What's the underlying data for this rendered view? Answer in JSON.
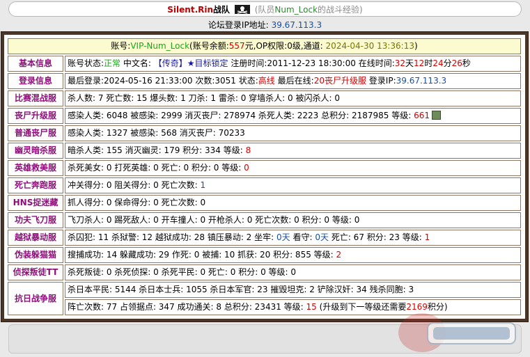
{
  "header": {
    "site": "Silent.Rin",
    "team_suffix": "战队",
    "member_prefix": "(队员",
    "member_name": "Num_Lock",
    "member_suffix": "的战斗经验)"
  },
  "ip_line": {
    "label": "论坛登录IP地址:",
    "value": "39.67.113.3"
  },
  "account": {
    "label": "账号:",
    "name": "VIP-Num_Lock",
    "balance_label": "(账号余额:",
    "balance": "557",
    "balance_unit": "元,OP权限:",
    "op_level": "0级,通道:",
    "datetime": "2024-04-30 13:36:13",
    "end": ")"
  },
  "rows": {
    "basic": {
      "label": "基本信息",
      "status_label": "账号状态:",
      "status": "正常",
      "cn_label": "中文名:",
      "cn_name": "【传奇】★目标锁定",
      "reg_label": "注册时间:",
      "reg_time": "2011-12-23 18:30:00",
      "online_label": "在线时间:",
      "days": "32",
      "d_unit": "天",
      "hours": "12",
      "h_unit": "时",
      "mins": "24",
      "m_unit": "分",
      "secs": "26",
      "s_unit": "秒"
    },
    "login": {
      "label": "登录信息",
      "last_label": "最后登录:",
      "last_time": "2024-05-16 21:33:00",
      "count_label": "次数:",
      "count": "3051",
      "state_label": "状态:",
      "state": "高线",
      "last_online_label": "最后在线:",
      "last_online": "20丧尸升级服",
      "ip_label": "登录IP:",
      "ip": "39.67.113.3"
    },
    "mix": {
      "label": "比赛混战服",
      "text": "杀人数: 7 死亡数: 15 爆头数: 1 刀杀: 1 雷杀: 0 穿墙杀人: 0 被闪杀人: 0"
    },
    "zombie_up": {
      "label": "丧尸升级服",
      "pre": "感染人类: 6048 被感染: 2999 消灭丧尸: 278974 杀死人类: 2223 总积分: 2187985 等级:",
      "level": "661"
    },
    "zombie": {
      "label": "普通丧尸服",
      "text": "感染人类: 1327 被感染: 568 消灭丧尸: 70233"
    },
    "ghost": {
      "label": "幽灵暗杀服",
      "pre": "暗杀人类: 155 消灭幽灵: 179 积分: 334 等级:",
      "level": "8"
    },
    "hero": {
      "label": "英雄救美服",
      "pre": "杀死美女: 0 打死英雄: 0 死亡: 0 积分: 0 等级:",
      "level": "0"
    },
    "run": {
      "label": "死亡奔跑服",
      "pre": "冲关得分: 0 阻关得分: 0 死亡次数:",
      "level": "1"
    },
    "hns": {
      "label": "HNS捉迷藏",
      "text": "抓人得分: 0 保命得分: 0 死亡次数: 0"
    },
    "kungfu": {
      "label": "功夫飞刀服",
      "text": "飞刀杀人: 0 踢死敌人: 0 开车撞人: 0 开枪杀人: 0 死亡次数: 0 积分: 0 等级: 0"
    },
    "jail": {
      "label": "越狱暴动服",
      "pre": "杀囚犯: 11 杀狱警: 12 越狱成功: 28 镇压暴动: 2 坐牢:",
      "jail_days": "0天",
      "mid": "看守:",
      "guard_days": "0天",
      "post": "死亡: 67 积分: 23 等级:",
      "level": "1"
    },
    "disguise": {
      "label": "伪装躲猫猫",
      "pre": "搜捕成功: 14 躲藏成功: 29 作死: 0 被捕: 10 抓获: 20 积分: 855 等级:",
      "level": "2"
    },
    "scout": {
      "label": "侦探叛徒TT",
      "text": "杀死叛徒: 0 杀死侦探: 0 杀死平民: 0 死亡: 0 积分: 0 等级: 0"
    },
    "war": {
      "label": "抗日战争服",
      "line1": "杀日本平民: 5144 杀日本士兵: 1055 杀日本军官: 23 摧毁坦克: 2 铲除汉奸: 34 残杀同胞: 3",
      "line2_pre": "阵亡次数: 77 占领据点: 347 成功通关: 8 总积分: 23431 等级:",
      "level": "15",
      "line2_post": "(升级到下一等级还需要",
      "need": "2169",
      "line2_end": "积分)"
    }
  },
  "colors": {
    "frame": "#4a3526",
    "label": "#8f0e7a",
    "highlight": "#d40000",
    "ok": "#18a818",
    "link": "#1a4fa0",
    "account_bg": "#fcfacf"
  }
}
